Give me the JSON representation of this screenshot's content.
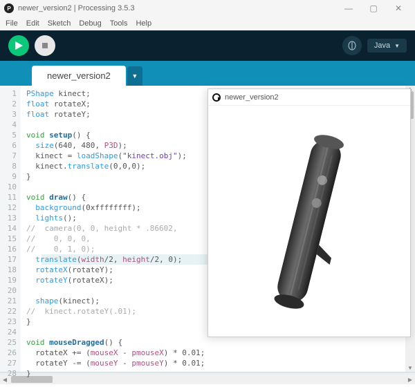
{
  "window": {
    "title": "newer_version2 | Processing 3.5.3",
    "min": "—",
    "max": "▢",
    "close": "✕"
  },
  "menu": [
    "File",
    "Edit",
    "Sketch",
    "Debug",
    "Tools",
    "Help"
  ],
  "mode": {
    "label": "Java",
    "caret": "▼"
  },
  "tabs": {
    "active": "newer_version2",
    "add": "▼"
  },
  "output": {
    "title": "newer_version2"
  },
  "code": {
    "lines": [
      [
        {
          "c": "hl",
          "t": "PShape"
        },
        {
          "c": "op",
          "t": " kinect;"
        }
      ],
      [
        {
          "c": "hl",
          "t": "float"
        },
        {
          "c": "op",
          "t": " rotateX;"
        }
      ],
      [
        {
          "c": "hl",
          "t": "float"
        },
        {
          "c": "op",
          "t": " rotateY;"
        }
      ],
      [],
      [
        {
          "c": "kw",
          "t": "void"
        },
        {
          "c": "op",
          "t": " "
        },
        {
          "c": "fn",
          "t": "setup"
        },
        {
          "c": "op",
          "t": "() {"
        }
      ],
      [
        {
          "c": "op",
          "t": "  "
        },
        {
          "c": "hl",
          "t": "size"
        },
        {
          "c": "op",
          "t": "(640, 480, "
        },
        {
          "c": "field",
          "t": "P3D"
        },
        {
          "c": "op",
          "t": ");"
        }
      ],
      [
        {
          "c": "op",
          "t": "  kinect = "
        },
        {
          "c": "hl",
          "t": "loadShape"
        },
        {
          "c": "op",
          "t": "("
        },
        {
          "c": "str",
          "t": "\"kinect.obj\""
        },
        {
          "c": "op",
          "t": ");"
        }
      ],
      [
        {
          "c": "op",
          "t": "  kinect."
        },
        {
          "c": "hl",
          "t": "translate"
        },
        {
          "c": "op",
          "t": "(0,0,0);"
        }
      ],
      [
        {
          "c": "op",
          "t": "}"
        }
      ],
      [],
      [
        {
          "c": "kw",
          "t": "void"
        },
        {
          "c": "op",
          "t": " "
        },
        {
          "c": "fn",
          "t": "draw"
        },
        {
          "c": "op",
          "t": "() {"
        }
      ],
      [
        {
          "c": "op",
          "t": "  "
        },
        {
          "c": "hl",
          "t": "background"
        },
        {
          "c": "op",
          "t": "(0xffffffff);"
        }
      ],
      [
        {
          "c": "op",
          "t": "  "
        },
        {
          "c": "hl",
          "t": "lights"
        },
        {
          "c": "op",
          "t": "();"
        }
      ],
      [
        {
          "c": "cm",
          "t": "//  camera(0, 0, height * .86602,"
        }
      ],
      [
        {
          "c": "cm",
          "t": "//    0, 0, 0,"
        }
      ],
      [
        {
          "c": "cm",
          "t": "//    0, 1, 0);"
        }
      ],
      [
        {
          "c": "op",
          "t": "  "
        },
        {
          "c": "hl",
          "t": "translate"
        },
        {
          "c": "op",
          "t": "("
        },
        {
          "c": "field",
          "t": "width"
        },
        {
          "c": "op",
          "t": "/2, "
        },
        {
          "c": "field",
          "t": "height"
        },
        {
          "c": "op",
          "t": "/2, 0);"
        }
      ],
      [
        {
          "c": "op",
          "t": "  "
        },
        {
          "c": "hl",
          "t": "rotateX"
        },
        {
          "c": "op",
          "t": "(rotateY);"
        }
      ],
      [
        {
          "c": "op",
          "t": "  "
        },
        {
          "c": "hl",
          "t": "rotateY"
        },
        {
          "c": "op",
          "t": "(rotateX);"
        }
      ],
      [],
      [
        {
          "c": "op",
          "t": "  "
        },
        {
          "c": "hl",
          "t": "shape"
        },
        {
          "c": "op",
          "t": "(kinect);"
        }
      ],
      [
        {
          "c": "cm",
          "t": "//  kinect.rotateY(.01);"
        }
      ],
      [
        {
          "c": "op",
          "t": "}"
        }
      ],
      [],
      [
        {
          "c": "kw",
          "t": "void"
        },
        {
          "c": "op",
          "t": " "
        },
        {
          "c": "fn",
          "t": "mouseDragged"
        },
        {
          "c": "op",
          "t": "() {"
        }
      ],
      [
        {
          "c": "op",
          "t": "  rotateX += ("
        },
        {
          "c": "field",
          "t": "mouseX"
        },
        {
          "c": "op",
          "t": " - "
        },
        {
          "c": "field",
          "t": "pmouseX"
        },
        {
          "c": "op",
          "t": ") * 0.01;"
        }
      ],
      [
        {
          "c": "op",
          "t": "  rotateY -= ("
        },
        {
          "c": "field",
          "t": "mouseY"
        },
        {
          "c": "op",
          "t": " - "
        },
        {
          "c": "field",
          "t": "pmouseY"
        },
        {
          "c": "op",
          "t": ") * 0.01;"
        }
      ],
      [
        {
          "c": "op",
          "t": "}"
        }
      ]
    ],
    "current_line_index": 16
  }
}
